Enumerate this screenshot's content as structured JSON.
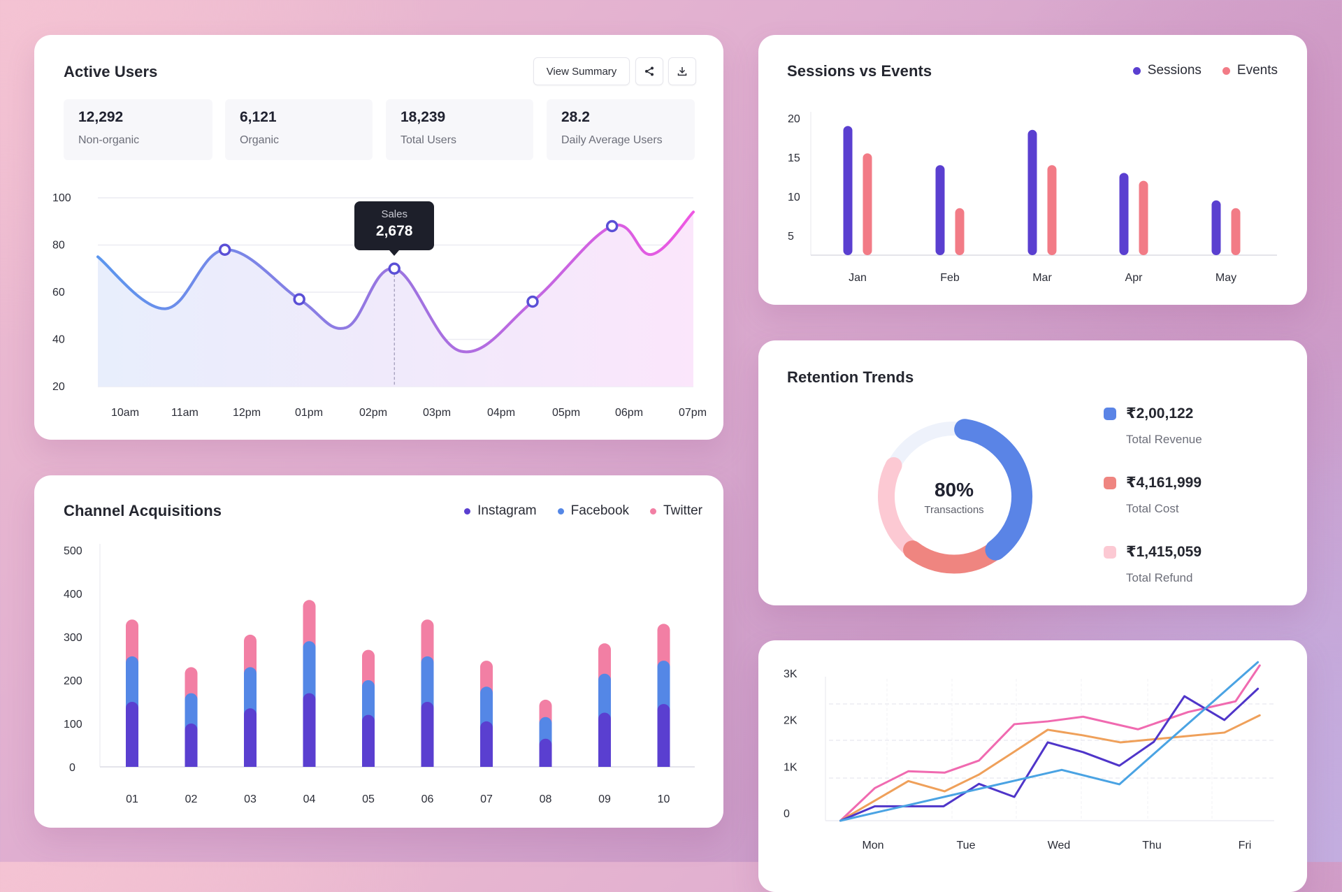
{
  "active_users": {
    "title": "Active Users",
    "view_summary_label": "View Summary",
    "share_icon": "share-icon",
    "download_icon": "download-icon",
    "stats": [
      {
        "value": "12,292",
        "label": "Non-organic"
      },
      {
        "value": "6,121",
        "label": "Organic"
      },
      {
        "value": "18,239",
        "label": "Total Users"
      },
      {
        "value": "28.2",
        "label": "Daily Average Users"
      }
    ],
    "tooltip": {
      "label": "Sales",
      "value": "2,678"
    }
  },
  "sessions_events": {
    "title": "Sessions vs Events",
    "legend": [
      {
        "name": "Sessions",
        "color": "#5a3fd0"
      },
      {
        "name": "Events",
        "color": "#f27b86"
      }
    ]
  },
  "retention": {
    "title": "Retention Trends",
    "center_value": "80%",
    "center_label": "Transactions",
    "items": [
      {
        "value": "₹2,00,122",
        "label": "Total Revenue",
        "color": "#5a84e6"
      },
      {
        "value": "₹4,161,999",
        "label": "Total Cost",
        "color": "#ef8580"
      },
      {
        "value": "₹1,415,059",
        "label": "Total Refund",
        "color": "#fcc9d3"
      }
    ]
  },
  "channel": {
    "title": "Channel Acquisitions",
    "legend": [
      {
        "name": "Instagram",
        "color": "#5a3fd0"
      },
      {
        "name": "Facebook",
        "color": "#5487e6"
      },
      {
        "name": "Twitter",
        "color": "#f27fa4"
      }
    ]
  },
  "chart_data": [
    {
      "id": "active-users",
      "type": "area",
      "title": "Active Users",
      "categories": [
        "10am",
        "11am",
        "12pm",
        "01pm",
        "02pm",
        "03pm",
        "04pm",
        "05pm",
        "06pm",
        "07pm"
      ],
      "yticks": [
        100,
        80,
        60,
        40,
        20
      ],
      "ylim": [
        20,
        100
      ],
      "series": [
        {
          "name": "Active Users",
          "points": [
            [
              -0.22,
              75
            ],
            [
              0.86,
              53
            ],
            [
              1.81,
              78
            ],
            [
              3.0,
              57
            ],
            [
              3.75,
              45
            ],
            [
              4.52,
              70
            ],
            [
              5.58,
              35
            ],
            [
              6.73,
              56
            ],
            [
              8.0,
              88
            ],
            [
              8.63,
              76
            ],
            [
              9.3,
              94
            ]
          ],
          "markers": [
            2,
            3,
            5,
            7,
            8
          ]
        }
      ],
      "highlight": {
        "point_index": 5,
        "label": "Sales",
        "value": "2,678"
      },
      "grid": true
    },
    {
      "id": "sessions-events",
      "type": "bar",
      "title": "Sessions vs Events",
      "categories": [
        "Jan",
        "Feb",
        "Mar",
        "Apr",
        "May"
      ],
      "yticks": [
        20,
        15,
        10,
        5
      ],
      "ylim": [
        2.5,
        21
      ],
      "series": [
        {
          "name": "Sessions",
          "values": [
            19,
            14,
            18.5,
            13,
            9.5
          ]
        },
        {
          "name": "Events",
          "values": [
            15.5,
            8.5,
            14,
            12,
            8.5
          ]
        }
      ],
      "legend": "top-right"
    },
    {
      "id": "channel-acquisitions",
      "type": "bar",
      "stacked": true,
      "title": "Channel Acquisitions",
      "categories": [
        "01",
        "02",
        "03",
        "04",
        "05",
        "06",
        "07",
        "08",
        "09",
        "10"
      ],
      "yticks": [
        500,
        400,
        300,
        200,
        100,
        0
      ],
      "ylim": [
        0,
        500
      ],
      "series": [
        {
          "name": "Instagram",
          "values": [
            150,
            100,
            135,
            170,
            120,
            150,
            105,
            65,
            125,
            145
          ]
        },
        {
          "name": "Facebook",
          "values": [
            105,
            70,
            95,
            120,
            80,
            105,
            80,
            50,
            90,
            100
          ]
        },
        {
          "name": "Twitter",
          "values": [
            85,
            60,
            75,
            95,
            70,
            85,
            60,
            40,
            70,
            85
          ]
        }
      ],
      "legend": "top-right"
    },
    {
      "id": "retention-trends",
      "type": "pie",
      "title": "Retention Trends",
      "center_text": "80%",
      "slices": [
        {
          "name": "Total Revenue",
          "value": 37
        },
        {
          "name": "Total Cost",
          "value": 21
        },
        {
          "name": "Total Refund",
          "value": 22
        }
      ],
      "total": 100
    },
    {
      "id": "weekly-trend",
      "type": "line",
      "title": "",
      "categories": [
        "Mon",
        "Tue",
        "Wed",
        "Thu",
        "Fri"
      ],
      "yticks": [
        {
          "value": 3,
          "label": "3K"
        },
        {
          "value": 2,
          "label": "2K"
        },
        {
          "value": 1,
          "label": "1K"
        },
        {
          "value": 0,
          "label": "0"
        }
      ],
      "ylim": [
        -0.18,
        3.3
      ],
      "xlim": [
        -0.35,
        4.3
      ],
      "series": [
        {
          "name": "pink",
          "color": "#f06ab0",
          "points": [
            [
              -0.35,
              -0.18
            ],
            [
              0.02,
              0.52
            ],
            [
              0.38,
              0.88
            ],
            [
              0.77,
              0.85
            ],
            [
              1.14,
              1.11
            ],
            [
              1.52,
              1.89
            ],
            [
              1.88,
              1.95
            ],
            [
              2.26,
              2.05
            ],
            [
              2.85,
              1.78
            ],
            [
              3.39,
              2.15
            ],
            [
              3.9,
              2.38
            ],
            [
              4.16,
              3.15
            ]
          ]
        },
        {
          "name": "orange",
          "color": "#efa05a",
          "points": [
            [
              -0.35,
              -0.18
            ],
            [
              0.02,
              0.25
            ],
            [
              0.38,
              0.67
            ],
            [
              0.77,
              0.45
            ],
            [
              1.14,
              0.81
            ],
            [
              1.52,
              1.3
            ],
            [
              1.88,
              1.77
            ],
            [
              2.26,
              1.65
            ],
            [
              2.66,
              1.5
            ],
            [
              3.04,
              1.57
            ],
            [
              3.78,
              1.71
            ],
            [
              4.16,
              2.08
            ]
          ]
        },
        {
          "name": "indigo",
          "color": "#4f35c9",
          "points": [
            [
              -0.35,
              -0.18
            ],
            [
              0.02,
              0.13
            ],
            [
              0.76,
              0.13
            ],
            [
              1.14,
              0.61
            ],
            [
              1.52,
              0.33
            ],
            [
              1.88,
              1.5
            ],
            [
              2.26,
              1.29
            ],
            [
              2.65,
              1.0
            ],
            [
              3.02,
              1.51
            ],
            [
              3.35,
              2.49
            ],
            [
              3.78,
              1.98
            ],
            [
              4.14,
              2.65
            ]
          ]
        },
        {
          "name": "sky",
          "color": "#4aa3e3",
          "points": [
            [
              -0.35,
              -0.18
            ],
            [
              2.03,
              0.91
            ],
            [
              2.65,
              0.6
            ],
            [
              4.14,
              3.22
            ]
          ]
        }
      ],
      "grid": true
    }
  ]
}
